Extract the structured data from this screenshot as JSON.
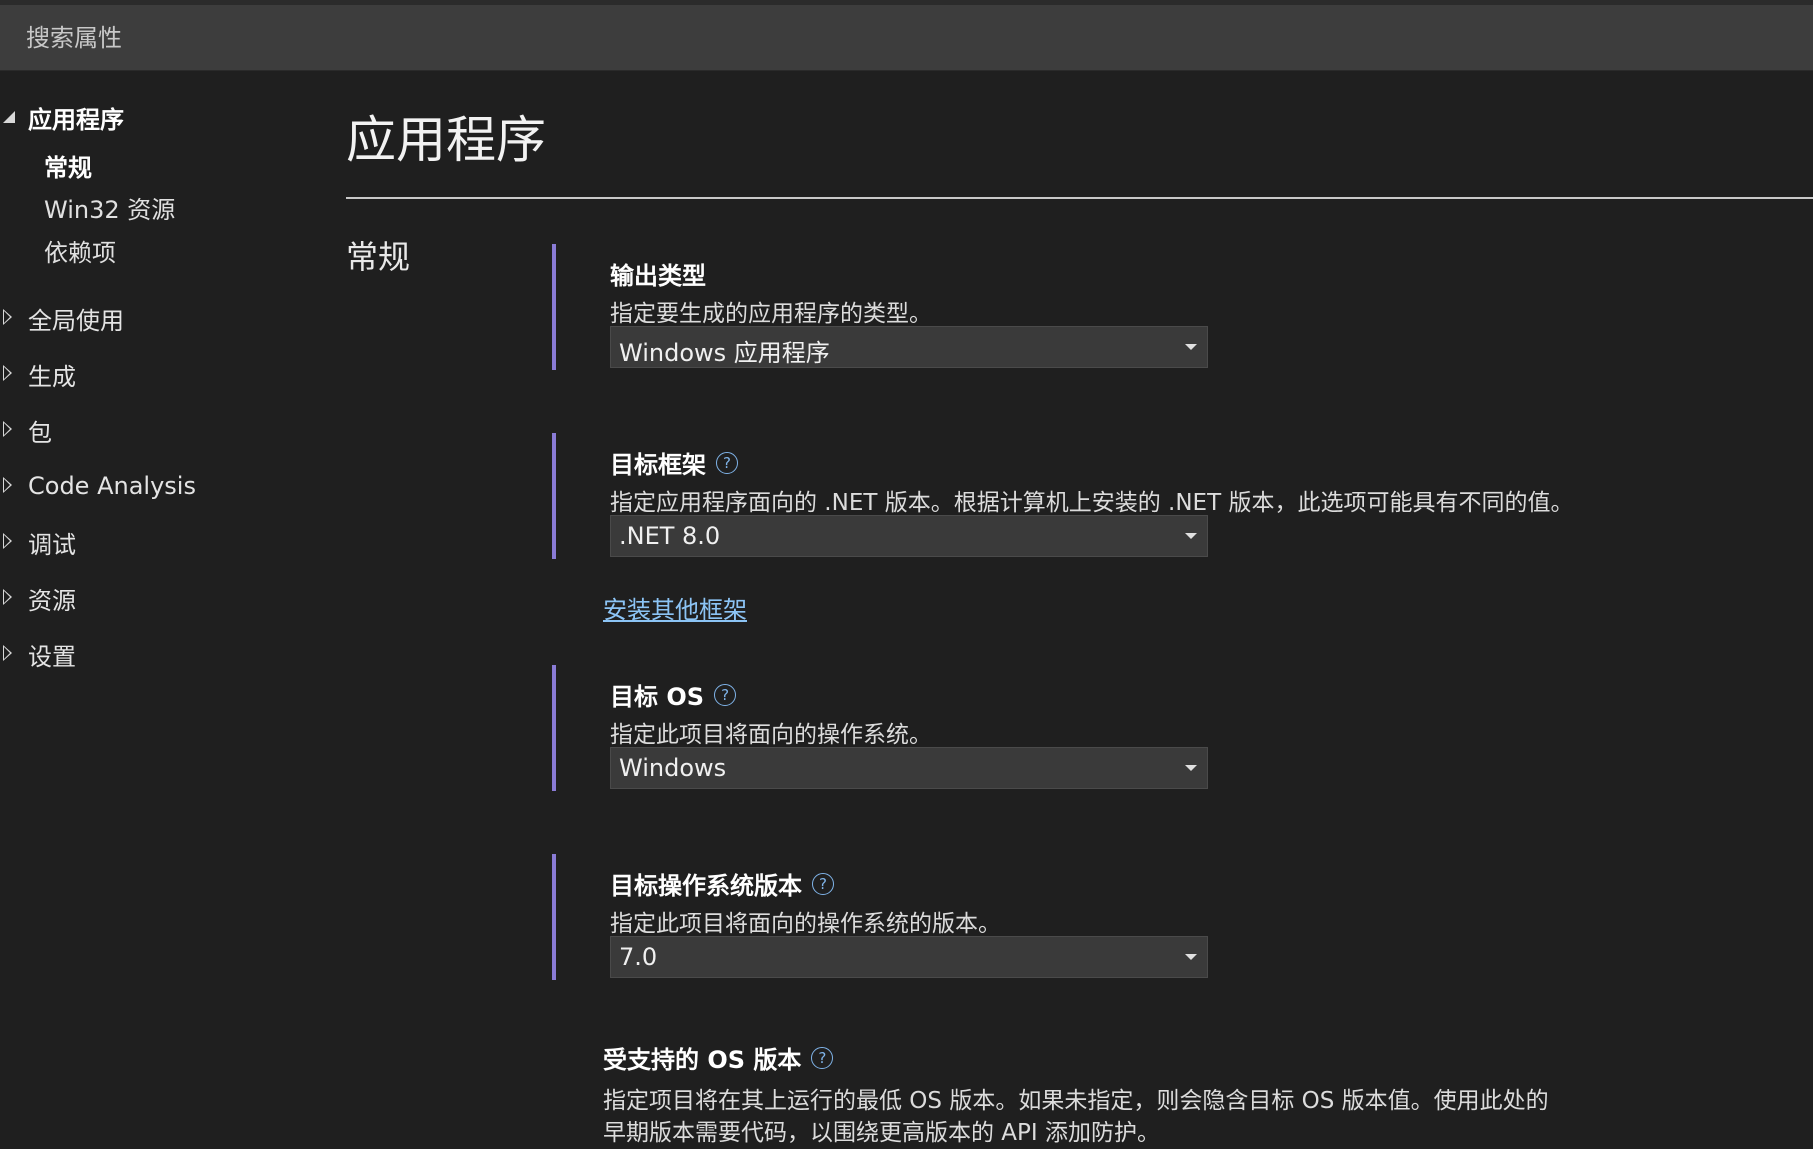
{
  "search": {
    "placeholder": "搜索属性"
  },
  "nav": {
    "groups": [
      {
        "label": "应用程序",
        "expanded": true,
        "items": [
          {
            "label": "常规",
            "active": true
          },
          {
            "label": "Win32 资源"
          },
          {
            "label": "依赖项"
          }
        ]
      },
      {
        "label": "全局使用",
        "expanded": false
      },
      {
        "label": "生成",
        "expanded": false
      },
      {
        "label": "包",
        "expanded": false
      },
      {
        "label": "Code Analysis",
        "expanded": false
      },
      {
        "label": "调试",
        "expanded": false
      },
      {
        "label": "资源",
        "expanded": false
      },
      {
        "label": "设置",
        "expanded": false
      }
    ]
  },
  "main": {
    "title": "应用程序",
    "section": "常规",
    "settings": [
      {
        "label": "输出类型",
        "description": "指定要生成的应用程序的类型。",
        "value": "Windows 应用程序",
        "help": false
      },
      {
        "label": "目标框架",
        "description": "指定应用程序面向的 .NET 版本。根据计算机上安装的 .NET 版本，此选项可能具有不同的值。",
        "value": ".NET 8.0",
        "help": true
      },
      {
        "label": "目标 OS",
        "description": "指定此项目将面向的操作系统。",
        "value": "Windows",
        "help": true
      },
      {
        "label": "目标操作系统版本",
        "description": "指定此项目将面向的操作系统的版本。",
        "value": "7.0",
        "help": true
      }
    ],
    "install_link": "安装其他框架",
    "supported_os": {
      "label": "受支持的 OS 版本",
      "description_line1": "指定项目将在其上运行的最低 OS 版本。如果未指定，则会隐含目标 OS 版本值。使用此处的",
      "description_line2": "早期版本需要代码，以围绕更高版本的 API 添加防护。"
    }
  },
  "colors": {
    "accent": "#8a7bd6",
    "link": "#8cc4f5",
    "background": "#1f1f1f",
    "search_bg": "#3d3d3d"
  },
  "icons": {
    "help": "?"
  }
}
